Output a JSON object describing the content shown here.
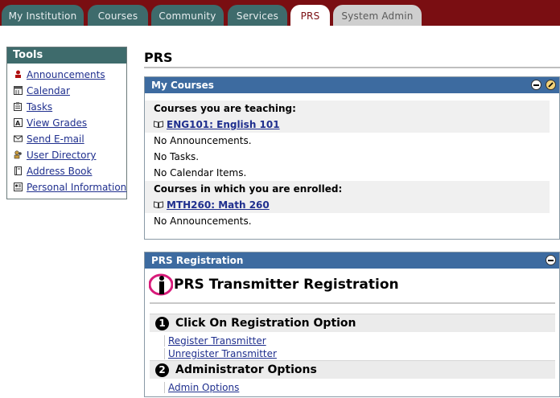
{
  "tabs": [
    {
      "label": "My Institution",
      "state": "normal"
    },
    {
      "label": "Courses",
      "state": "normal"
    },
    {
      "label": "Community",
      "state": "normal"
    },
    {
      "label": "Services",
      "state": "normal"
    },
    {
      "label": "PRS",
      "state": "active"
    },
    {
      "label": "System Admin",
      "state": "inactive"
    }
  ],
  "tools": {
    "title": "Tools",
    "items": [
      {
        "label": "Announcements",
        "icon": "announcements-icon"
      },
      {
        "label": "Calendar",
        "icon": "calendar-icon"
      },
      {
        "label": "Tasks",
        "icon": "tasks-icon"
      },
      {
        "label": "View Grades",
        "icon": "grades-icon"
      },
      {
        "label": "Send E-mail",
        "icon": "email-icon"
      },
      {
        "label": "User Directory",
        "icon": "user-directory-icon"
      },
      {
        "label": "Address Book",
        "icon": "address-book-icon"
      },
      {
        "label": "Personal Information",
        "icon": "personal-info-icon"
      }
    ]
  },
  "page": {
    "title": "PRS"
  },
  "my_courses": {
    "title": "My Courses",
    "teaching_heading": "Courses you are teaching:",
    "teaching_course": "ENG101: English 101",
    "teaching_lines": [
      "No Announcements.",
      "No Tasks.",
      "No Calendar Items."
    ],
    "enrolled_heading": "Courses in which you are enrolled:",
    "enrolled_course": "MTH260: Math 260",
    "enrolled_lines": [
      "No Announcements."
    ]
  },
  "prs_registration": {
    "title": "PRS Registration",
    "heading": "PRS Transmitter Registration",
    "step1": {
      "number": "1",
      "label": "Click On Registration Option"
    },
    "step1_options": [
      "Register Transmitter",
      "Unregister Transmitter"
    ],
    "step2": {
      "number": "2",
      "label": "Administrator Options"
    },
    "step2_options": [
      "Admin Options"
    ]
  },
  "colors": {
    "top_bar": "#7a0e12",
    "tab_teal": "#3e6b6c",
    "panel_header": "#3d6ba0",
    "link": "#1f2f8e"
  }
}
